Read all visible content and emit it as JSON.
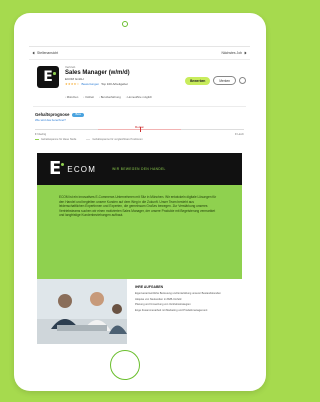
{
  "topbar": {
    "back_label": "Stellenansicht",
    "next_label": "Nächstes Job"
  },
  "job": {
    "category": "Vertrieb",
    "title": "Sales Manager (w/m/d)",
    "company": "ECOM GmbH",
    "stars": "★★★★☆",
    "reviews_label": "Bewertungen",
    "review_count": "Top 100 Arbeitgeber",
    "apply_label": "Bewerben",
    "save_label": "Merken",
    "info": [
      "München",
      "Vollzeit",
      "Berufserfahrung",
      "Homeoffice möglich"
    ]
  },
  "salary": {
    "title": "Gehaltsprognose",
    "badge": "Beta",
    "subtitle": "Wie wird das berechnet?",
    "median_label": "Median",
    "low": "€ Niedrig",
    "high": "€ Hoch",
    "legend": [
      "Gehaltsspanne für diese Stelle",
      "Gehaltsspanne für vergleichbare Positionen"
    ]
  },
  "banner": {
    "brand": "ECOM",
    "tagline": "WIR BEWEGEN DEN HANDEL",
    "body": "ECOM ist ein innovatives E-Commerce-Unternehmen mit Sitz in München. Wir entwickeln digitale Lösungen für den Handel und begleiten unsere Kunden auf dem Weg in die Zukunft. Unser Team besteht aus leidenschaftlichen Expertinnen und Experten, die gemeinsam Großes bewegen. Zur Verstärkung unseres Vertriebsteams suchen wir einen motivierten Sales Manager, der unsere Produkte mit Begeisterung vermarktet und langfristige Kundenbeziehungen aufbaut.",
    "section_title": "IHRE AUFGABEN",
    "items": [
      "Eigenverantwortliche Betreuung und Entwicklung unserer Bestandskunden",
      "Akquise von Neukunden im B2B-Umfeld",
      "Planung und Umsetzung von Vertriebsstrategien",
      "Enge Zusammenarbeit mit Marketing und Produktmanagement"
    ]
  },
  "colors": {
    "background": "#a6da4e",
    "accent": "#8fd14f",
    "apply_button": "#c8ec5c"
  }
}
